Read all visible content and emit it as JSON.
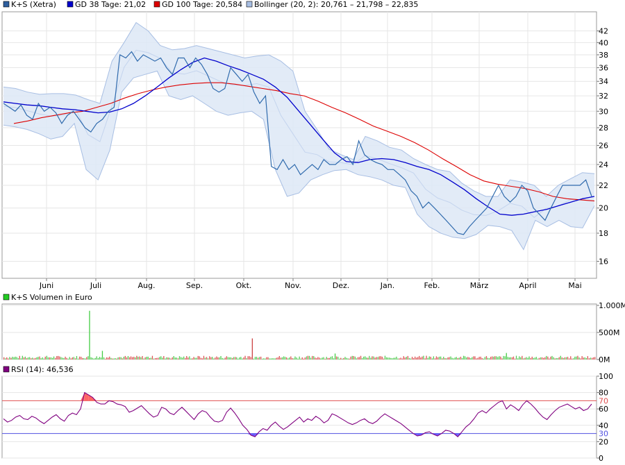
{
  "chart_data": [
    {
      "type": "line",
      "panel": "price",
      "legend": [
        {
          "label": "K+S (Xetra)",
          "color": "#2f5f9e"
        },
        {
          "label": "GD 38 Tage: 21,02",
          "color": "#0000cc"
        },
        {
          "label": "GD 100 Tage: 20,584",
          "color": "#dd0000"
        },
        {
          "label": "Bollinger (20, 2): 20,761 – 21,798 – 22,835",
          "color": "#a7bee3"
        }
      ],
      "x_tick_labels": [
        "Juni",
        "Juli",
        "Aug.",
        "Sep.",
        "Okt.",
        "Nov.",
        "Dez.",
        "Jan.",
        "Feb.",
        "März",
        "April",
        "Mai"
      ],
      "y_tick_labels": [
        "16",
        "18",
        "20",
        "22",
        "24",
        "26",
        "28",
        "30",
        "32",
        "34",
        "36",
        "38",
        "40",
        "42"
      ],
      "y_scale": "log",
      "ylim": [
        14.9,
        45.5
      ],
      "grid": true,
      "series": [
        {
          "name": "K+S (Xetra)",
          "color": "#2f6aad",
          "values": [
            31.0,
            30.5,
            30.0,
            30.8,
            29.5,
            29.0,
            31.0,
            30.0,
            30.5,
            29.8,
            28.5,
            29.5,
            30.0,
            29.0,
            28.0,
            27.5,
            28.5,
            29.0,
            30.0,
            30.5,
            38.0,
            37.5,
            38.5,
            37.0,
            38.0,
            37.5,
            37.0,
            37.5,
            36.0,
            35.0,
            37.5,
            37.5,
            36.0,
            37.5,
            36.5,
            35.0,
            33.0,
            32.5,
            33.0,
            36.0,
            35.0,
            34.0,
            35.0,
            32.5,
            31.0,
            32.0,
            23.8,
            23.5,
            24.5,
            23.5,
            24.0,
            23.0,
            23.5,
            24.0,
            23.5,
            24.5,
            24.0,
            24.0,
            24.5,
            24.8,
            24.0,
            26.5,
            25.0,
            24.5,
            24.2,
            24.0,
            23.5,
            23.5,
            23.0,
            22.5,
            21.5,
            21.0,
            20.0,
            20.5,
            20.0,
            19.5,
            19.0,
            18.5,
            18.0,
            17.9,
            18.5,
            19.0,
            19.5,
            20.0,
            21.0,
            22.0,
            21.0,
            20.5,
            21.0,
            22.0,
            21.5,
            20.0,
            19.5,
            19.0,
            20.0,
            21.0,
            22.0,
            22.0,
            22.0,
            22.0,
            22.5,
            21.0
          ]
        },
        {
          "name": "GD 38 Tage",
          "color": "#0000cc",
          "values": [
            31.2,
            31.0,
            30.8,
            30.7,
            30.5,
            30.3,
            30.2,
            30.0,
            29.8,
            29.9,
            30.3,
            31.0,
            32.0,
            33.2,
            34.5,
            35.7,
            36.8,
            37.5,
            37.0,
            36.3,
            35.7,
            35.0,
            34.3,
            33.2,
            31.8,
            30.0,
            28.3,
            26.7,
            25.2,
            24.3,
            24.2,
            24.5,
            24.6,
            24.5,
            24.2,
            23.8,
            23.5,
            23.0,
            22.3,
            21.6,
            20.8,
            20.1,
            19.5,
            19.4,
            19.5,
            19.7,
            19.9,
            20.2,
            20.5,
            20.8,
            21.0
          ]
        },
        {
          "name": "GD 100 Tage",
          "color": "#dd0000",
          "values": [
            28.5,
            28.8,
            29.2,
            29.5,
            29.8,
            30.0,
            30.5,
            31.0,
            31.7,
            32.3,
            32.8,
            33.2,
            33.5,
            33.7,
            33.8,
            33.8,
            33.6,
            33.3,
            33.0,
            32.7,
            32.3,
            32.0,
            31.3,
            30.5,
            29.8,
            29.0,
            28.2,
            27.6,
            27.0,
            26.3,
            25.5,
            24.6,
            23.8,
            23.0,
            22.4,
            22.1,
            21.9,
            21.7,
            21.4,
            21.0,
            20.8,
            20.7,
            20.6
          ]
        },
        {
          "name": "Bollinger",
          "color": "#a7bee3",
          "upper": [
            33.2,
            33.0,
            32.5,
            32.2,
            32.3,
            32.3,
            32.1,
            31.5,
            31.0,
            37.0,
            40.0,
            43.5,
            42.0,
            39.5,
            38.8,
            39.0,
            39.5,
            39.0,
            38.5,
            38.0,
            37.5,
            37.8,
            38.0,
            37.0,
            35.5,
            30.0,
            27.8,
            25.6,
            25.0,
            24.5,
            27.0,
            26.5,
            25.8,
            25.5,
            24.6,
            24.0,
            23.5,
            23.3,
            22.2,
            21.5,
            21.0,
            21.0,
            22.5,
            22.3,
            22.0,
            21.0,
            22.0,
            22.6,
            23.2,
            23.1
          ],
          "lower": [
            28.3,
            28.1,
            27.8,
            27.3,
            26.7,
            27.0,
            28.5,
            23.5,
            22.5,
            25.5,
            32.5,
            34.5,
            35.0,
            35.5,
            32.0,
            31.5,
            32.0,
            31.0,
            30.0,
            29.5,
            29.8,
            30.0,
            29.0,
            23.5,
            21.0,
            21.3,
            22.5,
            23.0,
            23.4,
            23.5,
            23.0,
            22.8,
            22.5,
            22.0,
            21.8,
            19.5,
            18.5,
            18.0,
            17.7,
            17.6,
            17.9,
            18.6,
            18.5,
            18.2,
            16.8,
            19.0,
            18.5,
            19.0,
            18.5,
            18.4,
            20.2
          ]
        }
      ]
    },
    {
      "type": "bar",
      "panel": "volume",
      "title": "K+S Volumen in Euro",
      "legend_color": "#22cc22",
      "y_tick_labels": [
        "0M",
        "500M",
        "1.000M"
      ],
      "ylim": [
        0,
        1000
      ],
      "spikes": [
        {
          "index": 60,
          "value": 900,
          "color": "#44cc44"
        },
        {
          "index": 174,
          "value": 390,
          "color": "#cc4444"
        },
        {
          "index": 69,
          "value": 160,
          "color": "#44cc44"
        },
        {
          "index": 232,
          "value": 110,
          "color": "#44cc44"
        },
        {
          "index": 352,
          "value": 120,
          "color": "#44cc44"
        }
      ],
      "count": 415
    },
    {
      "type": "line",
      "panel": "rsi",
      "title": "RSI (14): 46,536",
      "legend_color": "#800080",
      "color": "#800080",
      "y_tick_labels": [
        "0",
        "20",
        "40",
        "60",
        "80",
        "100"
      ],
      "overbought_label": "70",
      "oversold_label": "30",
      "ylim": [
        0,
        100
      ],
      "values": [
        48,
        44,
        46,
        50,
        52,
        48,
        47,
        51,
        49,
        45,
        42,
        46,
        50,
        53,
        48,
        45,
        52,
        55,
        53,
        60,
        80,
        77,
        74,
        68,
        66,
        66,
        70,
        69,
        66,
        65,
        63,
        56,
        58,
        61,
        64,
        59,
        54,
        50,
        52,
        62,
        60,
        55,
        53,
        58,
        62,
        57,
        52,
        47,
        54,
        58,
        56,
        50,
        45,
        44,
        46,
        56,
        61,
        55,
        48,
        40,
        35,
        28,
        26,
        32,
        36,
        34,
        40,
        44,
        39,
        35,
        38,
        42,
        46,
        50,
        44,
        48,
        46,
        51,
        48,
        43,
        46,
        54,
        52,
        49,
        46,
        43,
        41,
        43,
        46,
        48,
        44,
        42,
        45,
        50,
        54,
        51,
        48,
        45,
        42,
        38,
        34,
        30,
        27,
        28,
        31,
        32,
        29,
        27,
        30,
        34,
        33,
        30,
        26,
        32,
        38,
        42,
        48,
        55,
        58,
        55,
        60,
        64,
        68,
        70,
        60,
        65,
        62,
        58,
        65,
        70,
        66,
        61,
        55,
        50,
        47,
        53,
        58,
        62,
        64,
        66,
        63,
        60,
        62,
        58,
        60,
        66
      ]
    }
  ]
}
